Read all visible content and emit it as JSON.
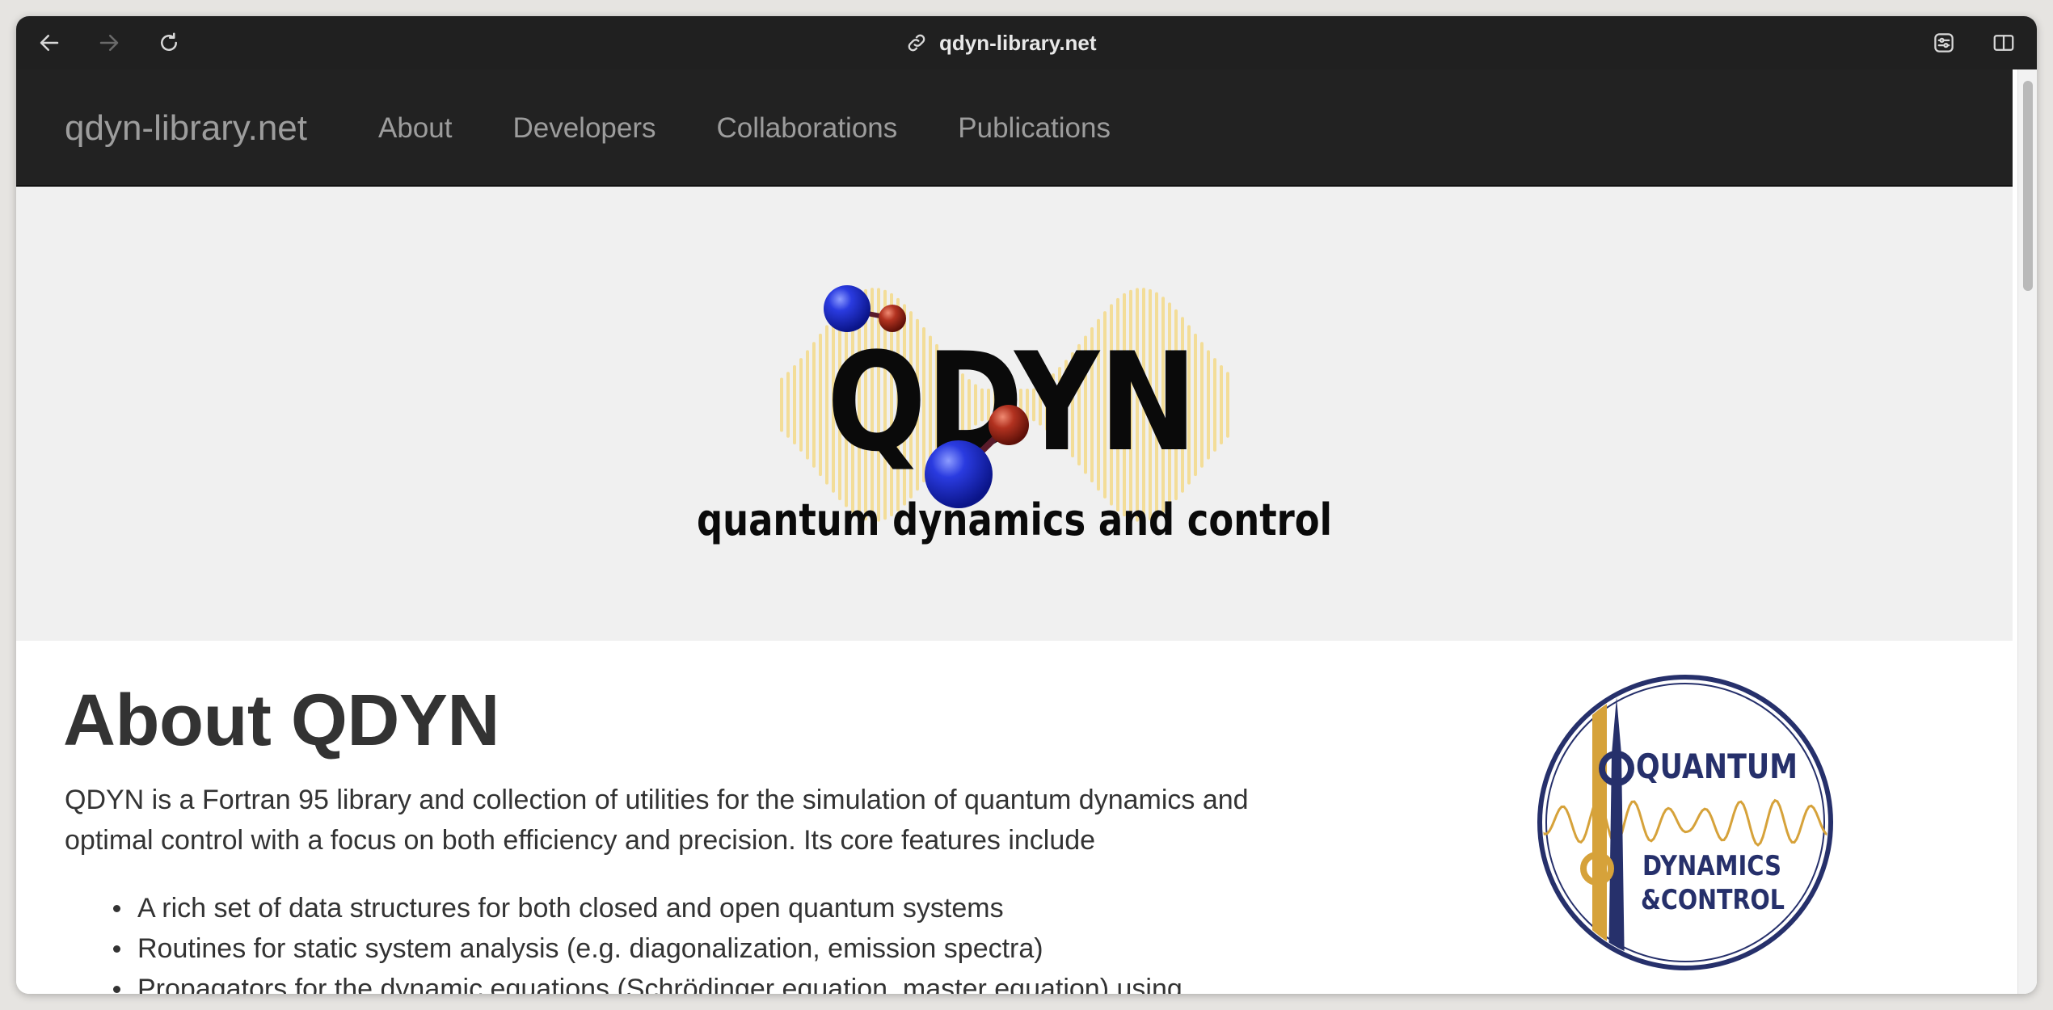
{
  "browser": {
    "url": "qdyn-library.net",
    "back_icon": "arrow-left-icon",
    "forward_icon": "arrow-right-icon",
    "reload_icon": "reload-icon",
    "link_icon": "link-icon",
    "settings_icon": "page-settings-icon",
    "sidebar_icon": "sidebar-icon"
  },
  "navbar": {
    "brand": "qdyn-library.net",
    "links": [
      "About",
      "Developers",
      "Collaborations",
      "Publications"
    ]
  },
  "hero": {
    "logo_title": "QDYN",
    "logo_subtitle": "quantum dynamics and control"
  },
  "main": {
    "heading": "About QDYN",
    "intro": "QDYN is a Fortran 95 library and collection of utilities for the simulation of quantum dynamics and optimal control with a focus on both efficiency and precision. Its core features include",
    "features": [
      "A rich set of data structures for both closed and open quantum systems",
      "Routines for static system analysis (e.g. diagonalization, emission spectra)",
      "Propagators for the dynamic equations (Schrödinger equation, master equation) using"
    ]
  },
  "badge": {
    "line1": "QUANTUM",
    "line2": "DYNAMICS",
    "line3": "&CONTROL"
  },
  "colors": {
    "navbar_bg": "#222222",
    "hero_bg": "#f0f0f0",
    "text": "#333333",
    "nav_text": "#9d9d9d",
    "badge_navy": "#26306b",
    "badge_gold": "#d6a23a",
    "wave_yellow": "#f3dd98",
    "atom_blue": "#1f2fd0",
    "atom_red": "#a3261a"
  }
}
